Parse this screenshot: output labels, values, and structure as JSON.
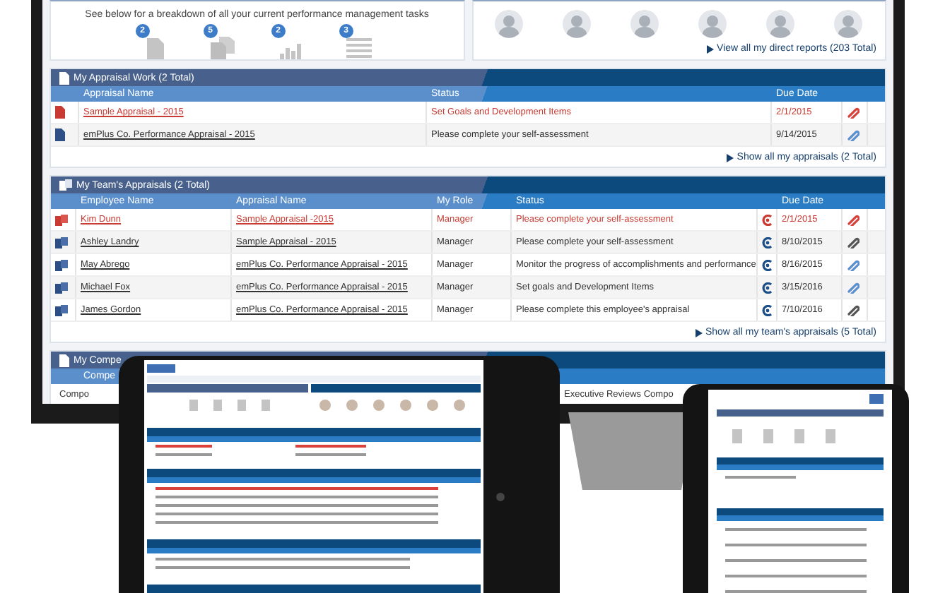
{
  "overview": {
    "intro": "See below for a breakdown of all your current performance management tasks",
    "tasks": [
      {
        "count": "2",
        "kind": "document"
      },
      {
        "count": "5",
        "kind": "documents"
      },
      {
        "count": "2",
        "kind": "chart"
      },
      {
        "count": "3",
        "kind": "list"
      }
    ]
  },
  "direct_reports": {
    "link": "View all my direct reports (203 Total)"
  },
  "appraisal_work": {
    "title": "My Appraisal Work (2 Total)",
    "columns": [
      "Appraisal Name",
      "Status",
      "Due Date"
    ],
    "rows": [
      {
        "name": "Sample Appraisal - 2015",
        "status": "Set Goals and Development Items",
        "due": "2/1/2015",
        "overdue": true,
        "color": "#d9413b"
      },
      {
        "name": "emPlus Co. Performance Appraisal - 2015",
        "status": "Please complete your self-assessment",
        "due": "9/14/2015",
        "overdue": false,
        "color": "#5b8fd0"
      }
    ],
    "link": "Show all my appraisals (2 Total)"
  },
  "team_appraisals": {
    "title": "My Team's Appraisals (2 Total)",
    "columns": [
      "Employee Name",
      "Appraisal Name",
      "My Role",
      "Status",
      "Due Date"
    ],
    "rows": [
      {
        "employee": "Kim Dunn",
        "appraisal": "Sample Appraisal -2015",
        "role": "Manager",
        "status": "Please complete your self-assessment",
        "due": "2/1/2015",
        "overdue": true,
        "color": "#d9413b"
      },
      {
        "employee": "Ashley Landry",
        "appraisal": "Sample Appraisal - 2015",
        "role": "Manager",
        "status": "Please complete your self-assessment",
        "due": "8/10/2015",
        "overdue": false,
        "color": "#555555"
      },
      {
        "employee": "May Abrego",
        "appraisal": "emPlus Co. Performance Appraisal - 2015",
        "role": "Manager",
        "status": "Monitor the progress of accomplishments and performance",
        "due": "8/16/2015",
        "overdue": false,
        "color": "#5b8fd0"
      },
      {
        "employee": "Michael Fox",
        "appraisal": "emPlus Co. Performance Appraisal - 2015",
        "role": "Manager",
        "status": "Set goals and Development Items",
        "due": "3/15/2016",
        "overdue": false,
        "color": "#5b8fd0"
      },
      {
        "employee": "James Gordon",
        "appraisal": "emPlus Co. Performance Appraisal - 2015",
        "role": "Manager",
        "status": "Please complete this employee's appraisal",
        "due": "7/10/2016",
        "overdue": false,
        "color": "#555555"
      }
    ],
    "link": "Show all my team's appraisals (5 Total)"
  },
  "compensation": {
    "title": "My Compe",
    "columns": [
      "Compe"
    ],
    "rows": [
      [
        "Compo",
        "Executive Reviews Compo"
      ]
    ]
  }
}
